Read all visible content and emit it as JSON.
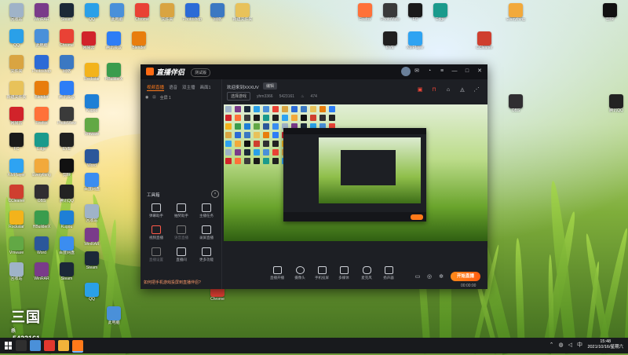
{
  "desktop": {
    "icons": [
      {
        "label": "回收站",
        "color": "#9fb3c8"
      },
      {
        "label": "WinRAR",
        "color": "#7a3b8a"
      },
      {
        "label": "Steam",
        "color": "#1b2838"
      },
      {
        "label": "QQ",
        "color": "#2aa0e8"
      },
      {
        "label": "此电脑",
        "color": "#4a90d9"
      },
      {
        "label": "Chrome",
        "color": "#e94235"
      },
      {
        "label": "文件夹",
        "color": "#d9a441"
      },
      {
        "label": "Photoshop",
        "color": "#2c6bd6"
      },
      {
        "label": "网络",
        "color": "#3b78c2"
      },
      {
        "label": "新建文件夹",
        "color": "#e8c25a"
      },
      {
        "label": "Blender",
        "color": "#e87d0d"
      },
      {
        "label": "腾讯会议",
        "color": "#2d7df6"
      },
      {
        "label": "网易云",
        "color": "#d1232a"
      },
      {
        "label": "Firefox",
        "color": "#ff7139"
      },
      {
        "label": "PhotoView",
        "color": "#3a3a3a"
      },
      {
        "label": "FC",
        "color": "#1a1a1a"
      },
      {
        "label": "Edge",
        "color": "#1a9a8c"
      },
      {
        "label": "EVE",
        "color": "#202020"
      },
      {
        "label": "KMPlayer",
        "color": "#2ea3f2"
      },
      {
        "label": "Everything",
        "color": "#f2a93b"
      },
      {
        "label": "剪映",
        "color": "#111111"
      },
      {
        "label": "CCleaner",
        "color": "#cf3f2f"
      },
      {
        "label": "OBS",
        "color": "#302e31"
      },
      {
        "label": "腾讯QQ",
        "color": "#222222"
      },
      {
        "label": "Rockstar",
        "color": "#f3b31b"
      },
      {
        "label": "HBuilderX",
        "color": "#3a9c4d"
      },
      {
        "label": "Kugou",
        "color": "#1e7fd6"
      },
      {
        "label": "Vmware",
        "color": "#62a845"
      },
      {
        "label": "Word",
        "color": "#2b579a"
      },
      {
        "label": "百度网盘",
        "color": "#3b8df0"
      }
    ]
  },
  "app": {
    "title": "直播伴侣",
    "version": "测试版",
    "tabs": [
      "视频直播",
      "语音",
      "双主播",
      "画面1"
    ],
    "active_tab": "视频直播",
    "scene_label": "全屏 1",
    "welcome": "欢迎来到XXXUV",
    "edit_label": "编辑",
    "game_tag": "选择游戏",
    "user_id": "yhm3366",
    "room_id": "5423161",
    "likes": "474",
    "tools_title": "工具箱",
    "tools": [
      {
        "label": "弹幕助手",
        "state": "normal"
      },
      {
        "label": "抽奖助手",
        "state": "normal"
      },
      {
        "label": "主播任务",
        "state": "normal"
      },
      {
        "label": "视频直播",
        "state": "red"
      },
      {
        "label": "语音直播",
        "state": "dim"
      },
      {
        "label": "录屏直播",
        "state": "normal"
      },
      {
        "label": "直播设置",
        "state": "dim"
      },
      {
        "label": "直播间",
        "state": "normal"
      },
      {
        "label": "更多功能",
        "state": "normal"
      }
    ],
    "help_text": "如何把手机游戏投屏到直播伴侣?",
    "controls": [
      "直播开播",
      "摄像头",
      "手机投屏",
      "多媒体",
      "麦克风",
      "扬声器"
    ],
    "start_button": "开始直播",
    "timer": "00:00:00"
  },
  "overlay": {
    "logo_text": "三国",
    "logo_sub": "杀",
    "streamer_id": "5423161"
  },
  "taskbar": {
    "apps": [
      {
        "name": "start-apps",
        "color": "#2f2f2f"
      },
      {
        "name": "browser-app",
        "color": "#4a90d9"
      },
      {
        "name": "red-app",
        "color": "#e2382e"
      },
      {
        "name": "chrome-app",
        "color": "#f2b33a"
      },
      {
        "name": "live-app",
        "color": "#ff7a1a"
      }
    ],
    "time": "15:48",
    "date": "2021/10/16/星期六"
  }
}
